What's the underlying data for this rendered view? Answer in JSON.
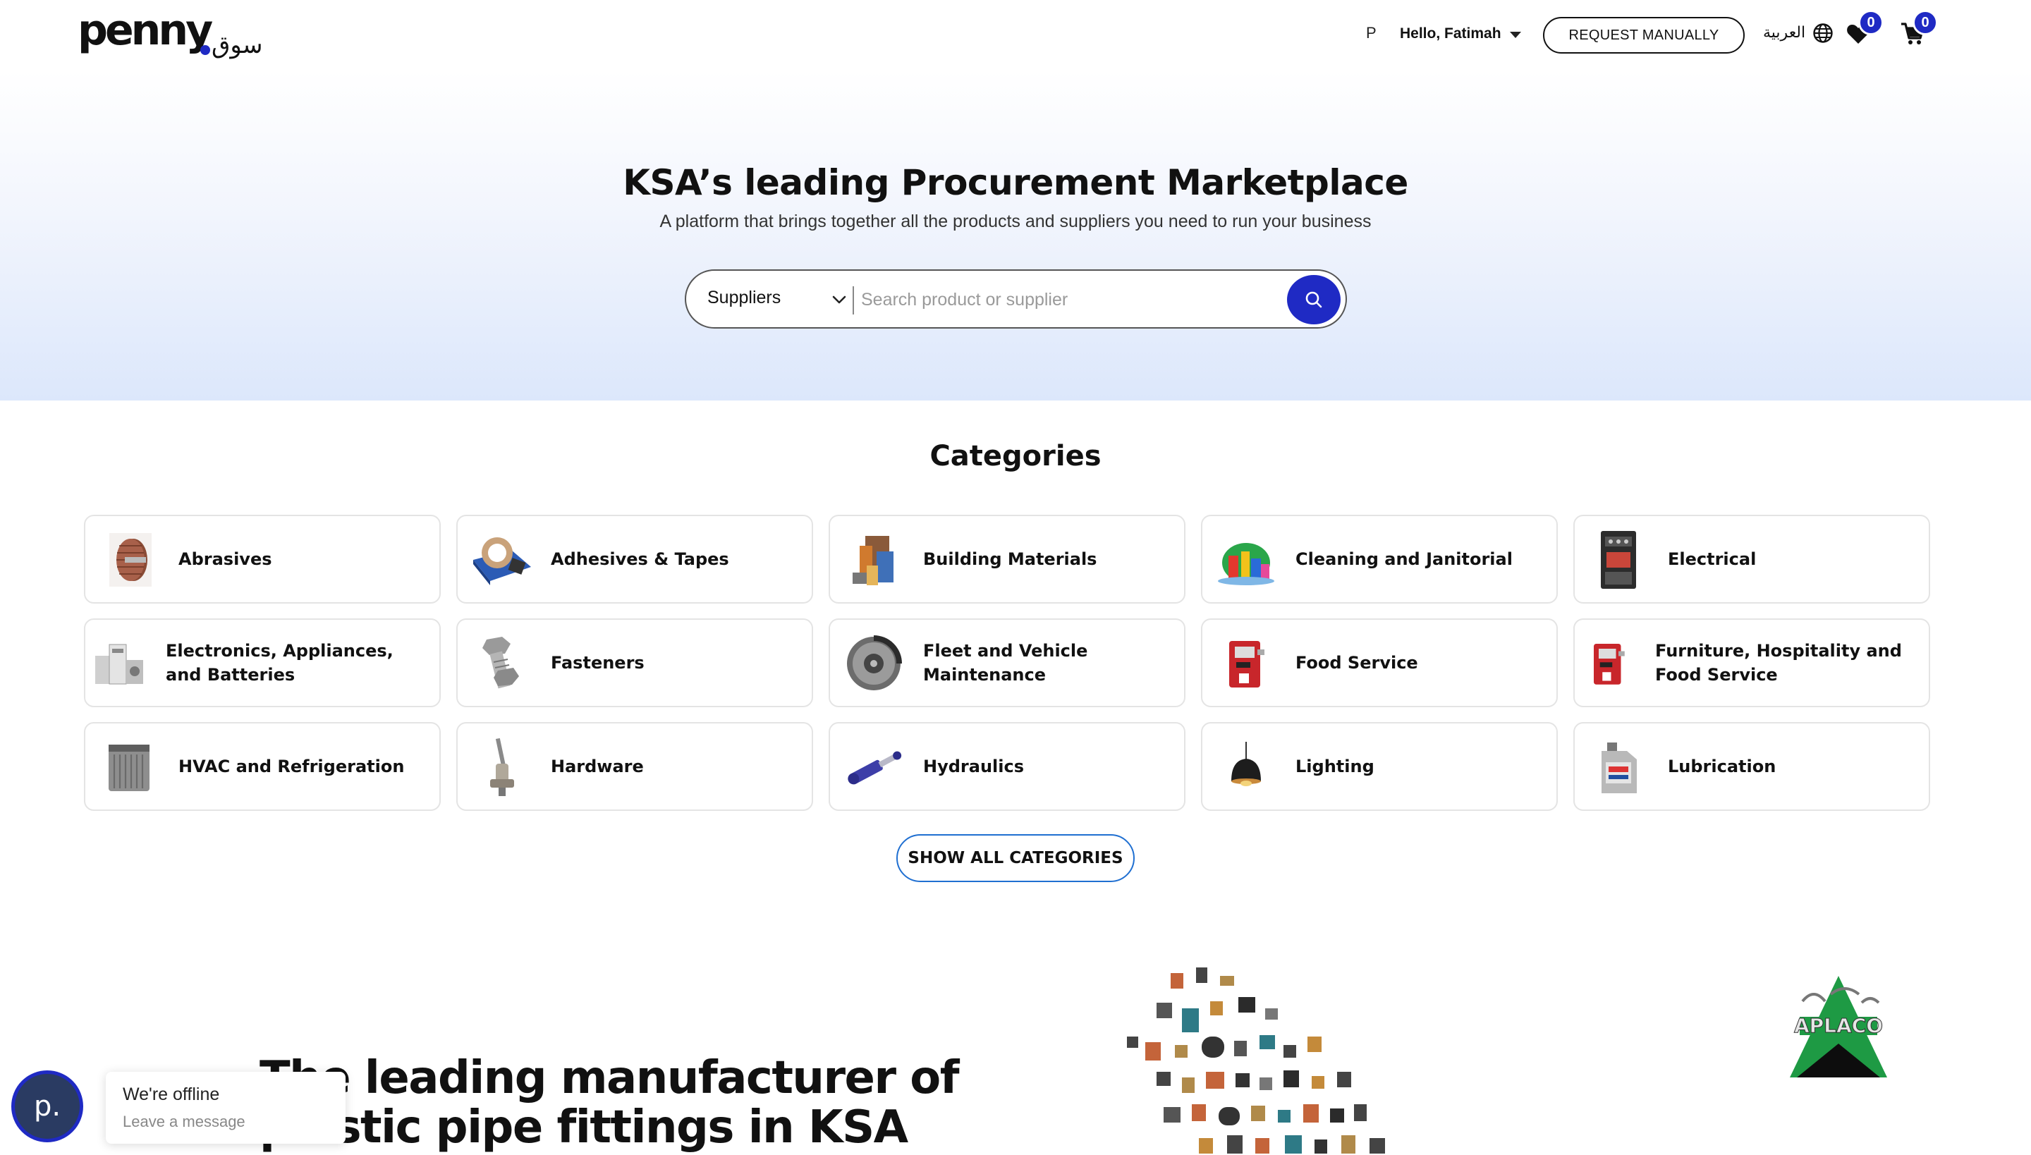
{
  "header": {
    "logo_text": "penny",
    "logo_arabic": "سوق",
    "user_initial": "P",
    "greeting": "Hello, Fatimah",
    "request_button": "REQUEST MANUALLY",
    "language": "العربية",
    "wishlist_count": "0",
    "cart_count": "0"
  },
  "hero": {
    "title": "KSA’s leading Procurement Marketplace",
    "subtitle": "A platform that brings together all the products and suppliers you need to run your business",
    "search_scope": "Suppliers",
    "search_placeholder": "Search product or supplier"
  },
  "categories": {
    "title": "Categories",
    "items": [
      {
        "label": "Abrasives",
        "icon": "abrasive-flap-wheel"
      },
      {
        "label": "Adhesives & Tapes",
        "icon": "tape-dispenser"
      },
      {
        "label": "Building Materials",
        "icon": "building-materials"
      },
      {
        "label": "Cleaning and Janitorial",
        "icon": "cleaning-supplies"
      },
      {
        "label": "Electrical",
        "icon": "contactor"
      },
      {
        "label": "Electronics, Appliances, and Batteries",
        "icon": "appliances"
      },
      {
        "label": "Fasteners",
        "icon": "bolt"
      },
      {
        "label": "Fleet and Vehicle Maintenance",
        "icon": "brake-disc"
      },
      {
        "label": "Food Service",
        "icon": "coffee-machine"
      },
      {
        "label": "Furniture, Hospitality and Food Service",
        "icon": "coffee-machine"
      },
      {
        "label": "HVAC and Refrigeration",
        "icon": "ac-unit"
      },
      {
        "label": "Hardware",
        "icon": "faucet-valve"
      },
      {
        "label": "Hydraulics",
        "icon": "hydraulic-cylinder"
      },
      {
        "label": "Lighting",
        "icon": "pendant-lamp"
      },
      {
        "label": "Lubrication",
        "icon": "oil-can"
      }
    ],
    "show_all": "SHOW ALL CATEGORIES"
  },
  "promo": {
    "title": "The leading manufacturer of plastic pipe fittings in KSA",
    "brand_logo": "APLACO"
  },
  "chat": {
    "avatar_letter": "p.",
    "status": "We're offline",
    "prompt": "Leave a message"
  },
  "colors": {
    "accent": "#1f2ac4",
    "outline_blue": "#1f6fd1"
  }
}
